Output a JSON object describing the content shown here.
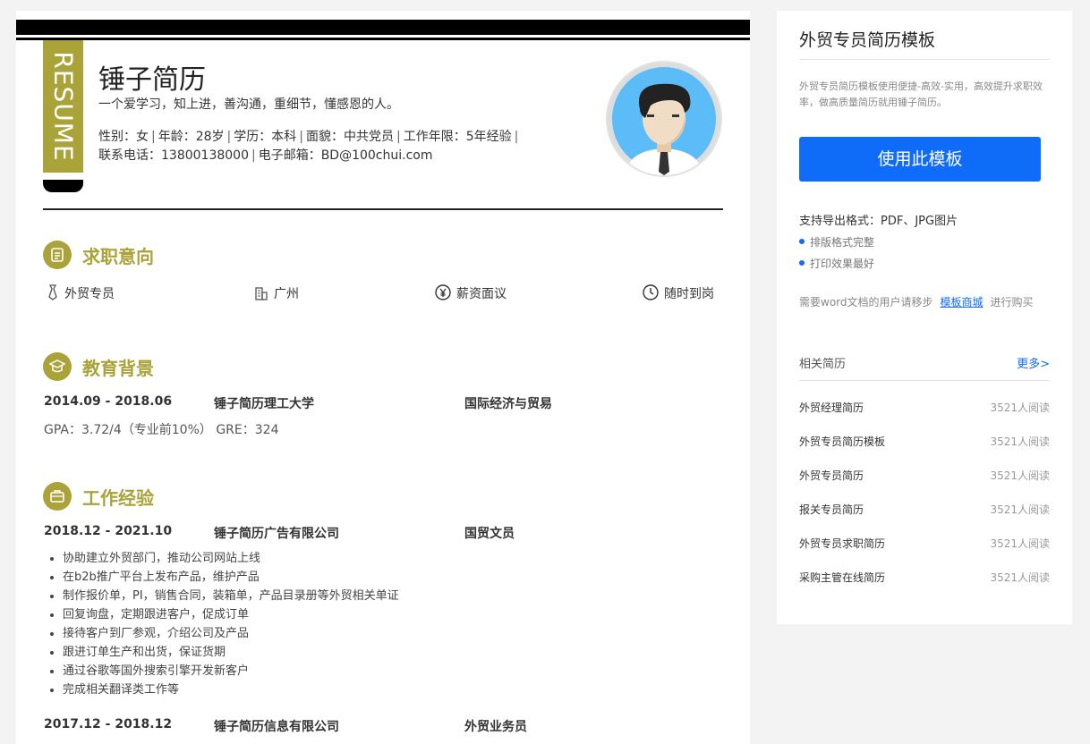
{
  "resume": {
    "tag": "RESUME",
    "name": "锤子简历",
    "motto": "一个爱学习，知上进，善沟通，重细节，懂感恩的人。",
    "info": {
      "gender": "性别：女",
      "age": "年龄：28岁",
      "degree": "学历：本科",
      "politics": "面貌：中共党员",
      "years": "工作年限：5年经验",
      "phone": "联系电话：13800138000",
      "email": "电子邮箱：BD@100chui.com"
    },
    "sections": {
      "intent": "求职意向",
      "education": "教育背景",
      "work": "工作经验"
    },
    "intent": {
      "position": "外贸专员",
      "city": "广州",
      "salary": "薪资面议",
      "arrival": "随时到岗"
    },
    "education": {
      "period": "2014.09 - 2018.06",
      "school": "锤子简历理工大学",
      "major": "国际经济与贸易",
      "score": "GPA：3.72/4（专业前10%） GRE：324"
    },
    "jobs": [
      {
        "period": "2018.12 - 2021.10",
        "company": "锤子简历广告有限公司",
        "title": "国贸文员",
        "duties": [
          "协助建立外贸部门，推动公司网站上线",
          "在b2b推广平台上发布产品，维护产品",
          "制作报价单，PI，销售合同，装箱单，产品目录册等外贸相关单证",
          "回复询盘，定期跟进客户，促成订单",
          "接待客户到厂参观，介绍公司及产品",
          "跟进订单生产和出货，保证货期",
          "通过谷歌等国外搜索引擎开发新客户",
          "完成相关翻译类工作等"
        ]
      },
      {
        "period": "2017.12 - 2018.12",
        "company": "锤子简历信息有限公司",
        "title": "外贸业务员"
      }
    ],
    "colors": {
      "accent": "#a9a33a",
      "dark": "#000000"
    }
  },
  "sidebar": {
    "title": "外贸专员简历模板",
    "desc": "外贸专员简历模板使用便捷-高效-实用，高效提升求职效率，做高质量简历就用锤子简历。",
    "use_button": "使用此模板",
    "formats": "支持导出格式：PDF、JPG图片",
    "bullets": [
      "排版格式完整",
      "打印效果最好"
    ],
    "word_note_pre": "需要word文档的用户请移步",
    "word_note_link": "模板商城",
    "word_note_post": "进行购买",
    "related_title": "相关简历",
    "more": "更多>",
    "related": [
      {
        "title": "外贸经理简历",
        "reads": "3521人阅读"
      },
      {
        "title": "外贸专员简历模板",
        "reads": "3521人阅读"
      },
      {
        "title": "外贸专员简历",
        "reads": "3521人阅读"
      },
      {
        "title": "报关专员简历",
        "reads": "3521人阅读"
      },
      {
        "title": "外贸专员求职简历",
        "reads": "3521人阅读"
      },
      {
        "title": "采购主管在线简历",
        "reads": "3521人阅读"
      }
    ],
    "colors": {
      "primary": "#0f6cf8"
    }
  }
}
